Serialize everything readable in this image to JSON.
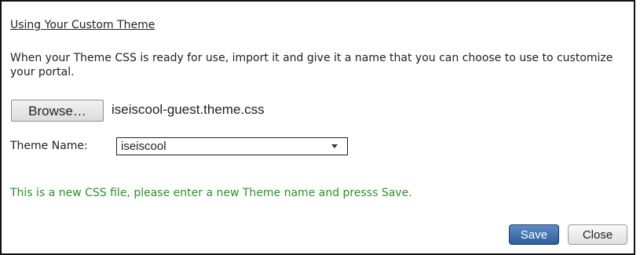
{
  "section": {
    "heading": "Using Your Custom Theme",
    "description": "When your Theme CSS is ready for use, import it and give it a name that you can choose to use to customize your portal."
  },
  "file_import": {
    "browse_label": "Browse…",
    "file_name": "iseiscool-guest.theme.css"
  },
  "theme": {
    "label": "Theme Name:",
    "selected_value": "iseiscool",
    "dropdown_icon": "chevron-down-icon"
  },
  "status": {
    "message": "This is a new CSS file, please enter a new Theme name and presss Save.",
    "color": "#2f8f2f"
  },
  "actions": {
    "save_label": "Save",
    "close_label": "Close",
    "save_color": "#2d5f9c"
  }
}
